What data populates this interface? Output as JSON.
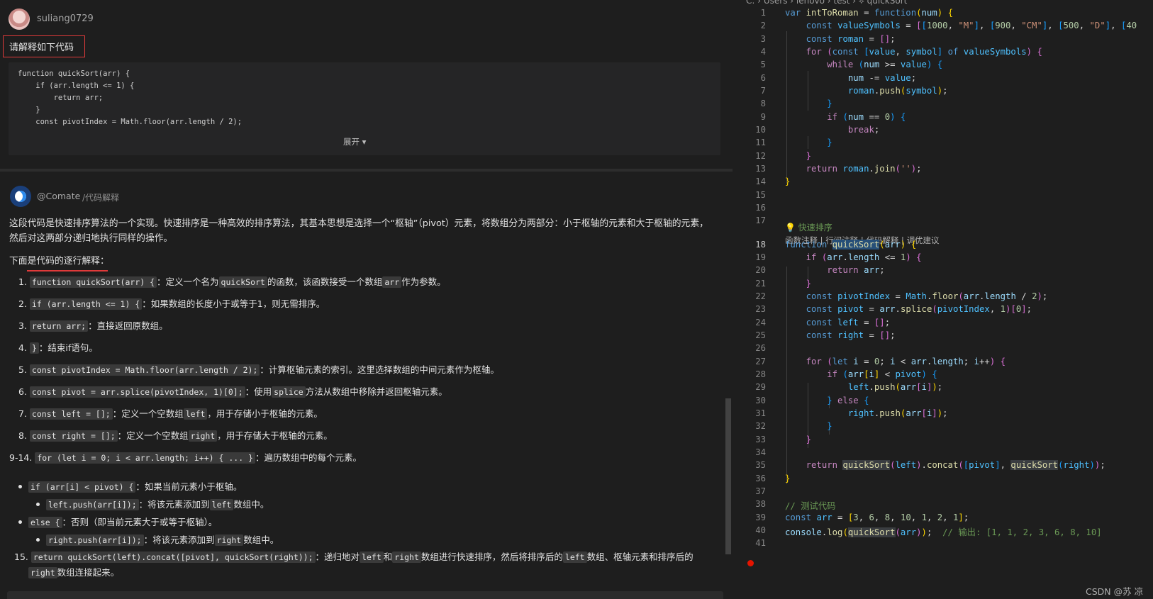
{
  "user_message": {
    "username": "suliang0729",
    "text": "请解释如下代码",
    "code_preview": [
      "function quickSort(arr) {",
      "    if (arr.length <= 1) {",
      "        return arr;",
      "    }",
      "    const pivotIndex = Math.floor(arr.length / 2);"
    ],
    "expand_label": "展开 ▾"
  },
  "bot_message": {
    "name": "@Comate",
    "command": "/代码解释",
    "intro_line1": "这段代码是快速排序算法的一个实现。快速排序是一种高效的排序算法，其基本思想是选择一个“枢轴”（pivot）元素，将数组分为两部分：小于枢轴的元素和大于枢轴的元素，",
    "intro_line2": "然后对这两部分递归地执行同样的操作。",
    "subheading": "下面是代码的逐行解释：",
    "items": [
      {
        "num": "1.",
        "code": "function quickSort(arr) {",
        "text_a": "：定义一个名为",
        "code2": "quickSort",
        "text_b": "的函数，该函数接受一个数组",
        "code3": "arr",
        "text_c": "作为参数。"
      },
      {
        "num": "2.",
        "code": "if (arr.length <= 1) {",
        "text_a": "：如果数组的长度小于或等于1，则无需排序。"
      },
      {
        "num": "3.",
        "code": "return arr;",
        "text_a": "：直接返回原数组。"
      },
      {
        "num": "4.",
        "code": "}",
        "text_a": "：结束if语句。"
      },
      {
        "num": "5.",
        "code": "const pivotIndex = Math.floor(arr.length / 2);",
        "text_a": "：计算枢轴元素的索引。这里选择数组的中间元素作为枢轴。"
      },
      {
        "num": "6.",
        "code": "const pivot = arr.splice(pivotIndex, 1)[0];",
        "text_a": "：使用",
        "code2": "splice",
        "text_b": "方法从数组中移除并返回枢轴元素。"
      },
      {
        "num": "7.",
        "code": "const left = [];",
        "text_a": "：定义一个空数组",
        "code2": "left",
        "text_b": "，用于存储小于枢轴的元素。"
      },
      {
        "num": "8.",
        "code": "const right = [];",
        "text_a": "：定义一个空数组",
        "code2": "right",
        "text_b": "，用于存储大于枢轴的元素。"
      },
      {
        "num": "9-14.",
        "code": "for (let i = 0; i < arr.length; i++) { ... }",
        "text_a": "：遍历数组中的每个元素。"
      }
    ],
    "bullets": [
      {
        "code": "if (arr[i] < pivot) {",
        "text": "：如果当前元素小于枢轴。"
      },
      {
        "code": "left.push(arr[i]);",
        "text_a": "：将该元素添加到",
        "code2": "left",
        "text_b": "数组中。"
      },
      {
        "code": "else {",
        "text": "：否则（即当前元素大于或等于枢轴）。"
      },
      {
        "code": "right.push(arr[i]);",
        "text_a": "：将该元素添加到",
        "code2": "right",
        "text_b": "数组中。"
      }
    ],
    "item15": {
      "num": "15.",
      "code": "return quickSort(left).concat([pivot], quickSort(right));",
      "text_a": "：递归地对",
      "code2": "left",
      "text_b": "和",
      "code3": "right",
      "text_c": "数组进行快速排序，然后将排序后的",
      "code4": "left",
      "text_d": "数组、枢轴元素和排序后的",
      "code5": "right",
      "text_e": "数组连接起来。"
    }
  },
  "editor": {
    "breadcrumb": "C: › Users › lenovo › test › ⟡ quickSort",
    "codelens_title": "💡 快速排序",
    "codelens_links": [
      "函数注释",
      "行间注释",
      "代码解释",
      "调优建议"
    ],
    "codelens_sep": " | ",
    "active_line": 18,
    "breakpoint_line": 41,
    "line_numbers": [
      "1",
      "2",
      "3",
      "4",
      "5",
      "6",
      "7",
      "8",
      "9",
      "10",
      "11",
      "12",
      "13",
      "14",
      "15",
      "16",
      "17",
      "18",
      "19",
      "20",
      "21",
      "22",
      "23",
      "24",
      "25",
      "26",
      "27",
      "28",
      "29",
      "30",
      "31",
      "32",
      "33",
      "34",
      "35",
      "36",
      "37",
      "38",
      "39",
      "40",
      "41"
    ]
  },
  "watermark": "CSDN @苏 凉"
}
